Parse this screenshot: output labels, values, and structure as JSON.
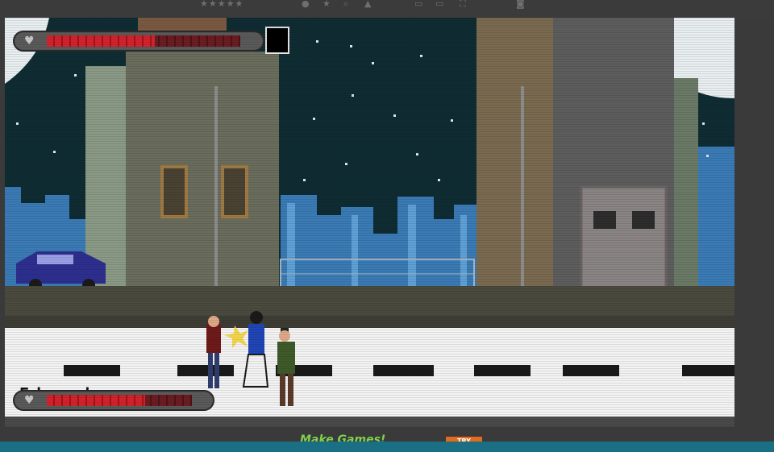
{
  "toolbar": {
    "rating_stars": "★★★★★"
  },
  "hud": {
    "boss_health": 0.56,
    "player_health": 0.68,
    "player_name": "Edward",
    "boss_portrait": "boss-portrait-icon"
  },
  "footer": {
    "banner_text": "Make Games!",
    "banner_tag": "TRY"
  },
  "colors": {
    "sky": "#0f2c33",
    "health_red": "#d3232d",
    "road": "#f3f3f3",
    "dash": "#1a1a1a",
    "taskbar": "#1b6f85"
  }
}
